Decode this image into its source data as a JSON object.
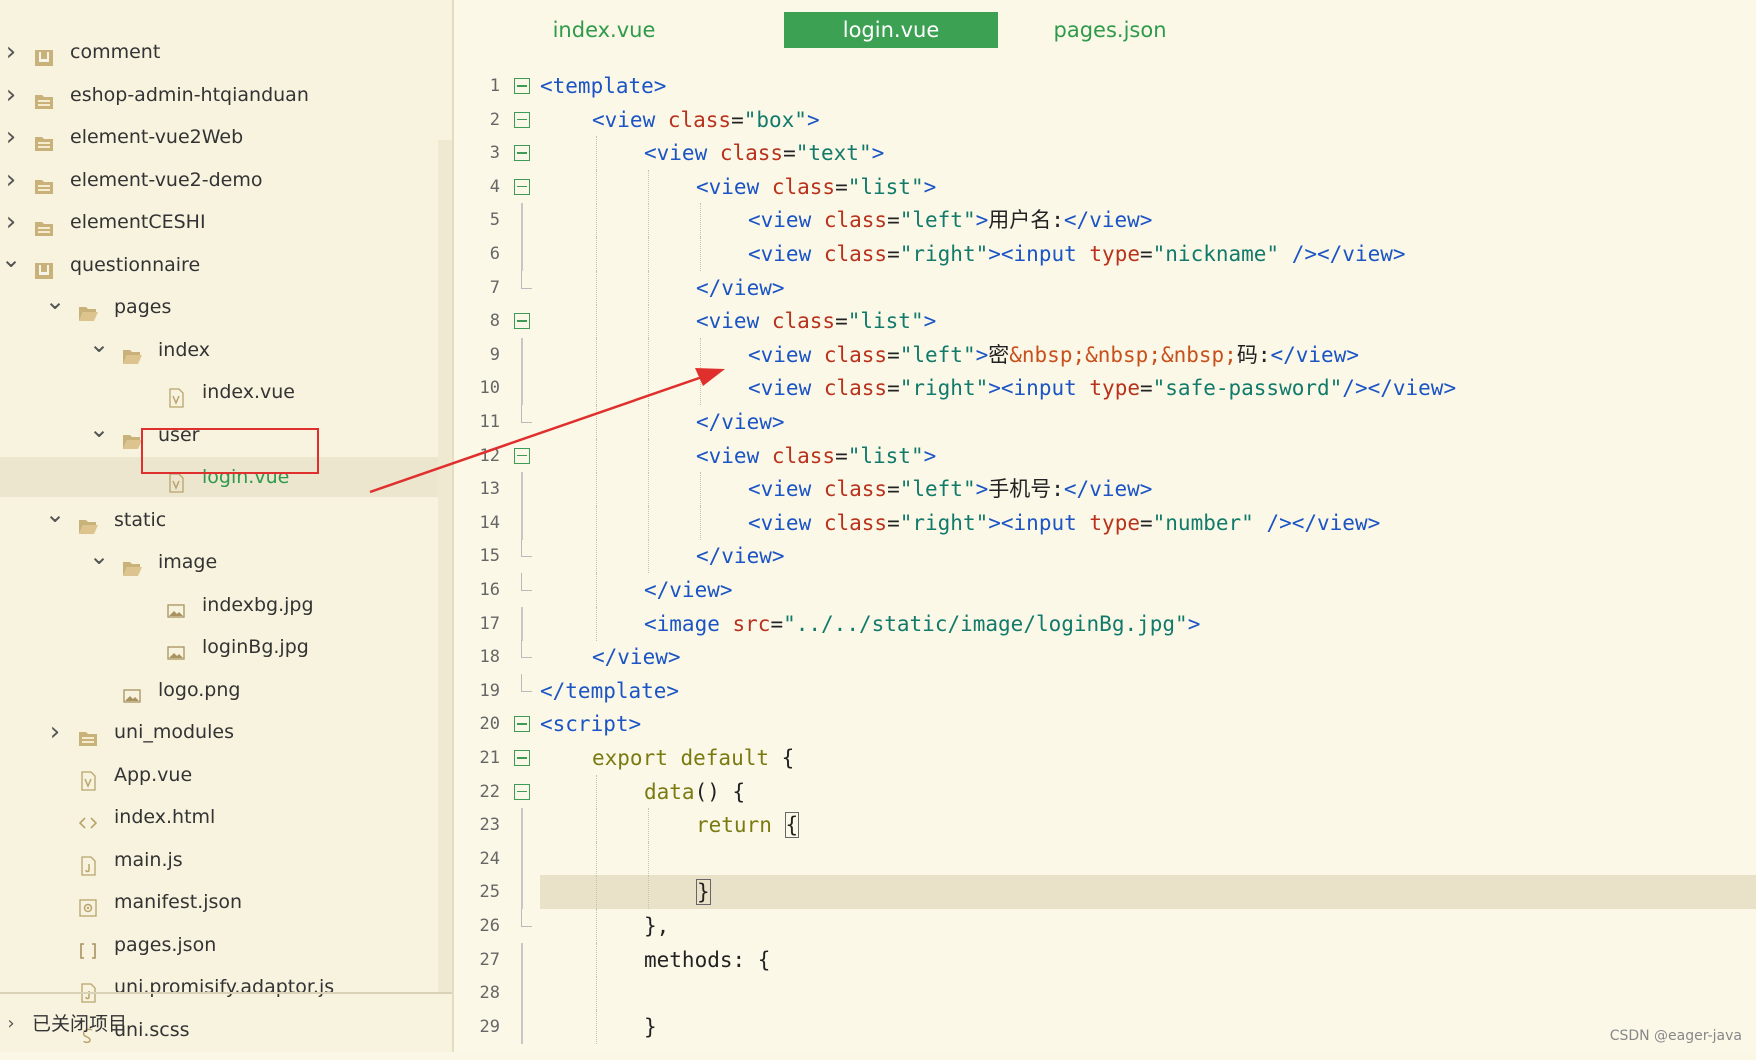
{
  "tabs": [
    {
      "label": "index.vue",
      "active": false
    },
    {
      "label": "login.vue",
      "active": true
    },
    {
      "label": "pages.json",
      "active": false
    }
  ],
  "tree": [
    {
      "label": "comment",
      "depth": 0,
      "expand": "collapsed",
      "icon": "project-icon"
    },
    {
      "label": "eshop-admin-htqianduan",
      "depth": 0,
      "expand": "collapsed",
      "icon": "folder-icon"
    },
    {
      "label": "element-vue2Web",
      "depth": 0,
      "expand": "collapsed",
      "icon": "folder-icon"
    },
    {
      "label": "element-vue2-demo",
      "depth": 0,
      "expand": "collapsed",
      "icon": "folder-icon"
    },
    {
      "label": "elementCESHI",
      "depth": 0,
      "expand": "collapsed",
      "icon": "folder-icon"
    },
    {
      "label": "questionnaire",
      "depth": 0,
      "expand": "expanded",
      "icon": "project-icon"
    },
    {
      "label": "pages",
      "depth": 1,
      "expand": "expanded",
      "icon": "open-folder-icon"
    },
    {
      "label": "index",
      "depth": 2,
      "expand": "expanded",
      "icon": "open-folder-icon"
    },
    {
      "label": "index.vue",
      "depth": 3,
      "expand": "none",
      "icon": "vue-file-icon"
    },
    {
      "label": "user",
      "depth": 2,
      "expand": "expanded",
      "icon": "open-folder-icon"
    },
    {
      "label": "login.vue",
      "depth": 3,
      "expand": "none",
      "icon": "vue-file-icon",
      "selected": true
    },
    {
      "label": "static",
      "depth": 1,
      "expand": "expanded",
      "icon": "open-folder-icon"
    },
    {
      "label": "image",
      "depth": 2,
      "expand": "expanded",
      "icon": "open-folder-icon"
    },
    {
      "label": "indexbg.jpg",
      "depth": 3,
      "expand": "none",
      "icon": "image-file-icon"
    },
    {
      "label": "loginBg.jpg",
      "depth": 3,
      "expand": "none",
      "icon": "image-file-icon"
    },
    {
      "label": "logo.png",
      "depth": 2,
      "expand": "none",
      "icon": "image-file-icon"
    },
    {
      "label": "uni_modules",
      "depth": 1,
      "expand": "collapsed",
      "icon": "folder-icon"
    },
    {
      "label": "App.vue",
      "depth": 1,
      "expand": "none",
      "icon": "vue-file-icon"
    },
    {
      "label": "index.html",
      "depth": 1,
      "expand": "none",
      "icon": "html-file-icon"
    },
    {
      "label": "main.js",
      "depth": 1,
      "expand": "none",
      "icon": "js-file-icon"
    },
    {
      "label": "manifest.json",
      "depth": 1,
      "expand": "none",
      "icon": "manifest-file-icon"
    },
    {
      "label": "pages.json",
      "depth": 1,
      "expand": "none",
      "icon": "json-file-icon"
    },
    {
      "label": "uni.promisify.adaptor.js",
      "depth": 1,
      "expand": "none",
      "icon": "js-file-icon"
    },
    {
      "label": "uni.scss",
      "depth": 1,
      "expand": "none",
      "icon": "scss-file-icon"
    }
  ],
  "closed_projects": "已关闭项目",
  "code_lines": [
    {
      "n": "1",
      "marker": "fold",
      "indent": 0,
      "tokens": [
        [
          "t",
          "<template>"
        ]
      ]
    },
    {
      "n": "2",
      "marker": "fold",
      "indent": 1,
      "tokens": [
        [
          "t",
          "<view "
        ],
        [
          "a",
          "class"
        ],
        [
          "x",
          "="
        ],
        [
          "s",
          "\"box\""
        ],
        [
          "t",
          ">"
        ]
      ]
    },
    {
      "n": "3",
      "marker": "fold",
      "indent": 2,
      "tokens": [
        [
          "t",
          "<view "
        ],
        [
          "a",
          "class"
        ],
        [
          "x",
          "="
        ],
        [
          "s",
          "\"text\""
        ],
        [
          "t",
          ">"
        ]
      ]
    },
    {
      "n": "4",
      "marker": "fold",
      "indent": 3,
      "tokens": [
        [
          "t",
          "<view "
        ],
        [
          "a",
          "class"
        ],
        [
          "x",
          "="
        ],
        [
          "s",
          "\"list\""
        ],
        [
          "t",
          ">"
        ]
      ]
    },
    {
      "n": "5",
      "marker": "bar",
      "indent": 4,
      "tokens": [
        [
          "t",
          "<view "
        ],
        [
          "a",
          "class"
        ],
        [
          "x",
          "="
        ],
        [
          "s",
          "\"left\""
        ],
        [
          "t",
          ">"
        ],
        [
          "x",
          "用户名:"
        ],
        [
          "t",
          "</view>"
        ]
      ]
    },
    {
      "n": "6",
      "marker": "bar",
      "indent": 4,
      "tokens": [
        [
          "t",
          "<view "
        ],
        [
          "a",
          "class"
        ],
        [
          "x",
          "="
        ],
        [
          "s",
          "\"right\""
        ],
        [
          "t",
          "><input "
        ],
        [
          "a",
          "type"
        ],
        [
          "x",
          "="
        ],
        [
          "s",
          "\"nickname\""
        ],
        [
          "x",
          " "
        ],
        [
          "t",
          "/></view>"
        ]
      ]
    },
    {
      "n": "7",
      "marker": "end",
      "indent": 3,
      "tokens": [
        [
          "t",
          "</view>"
        ]
      ]
    },
    {
      "n": "8",
      "marker": "fold",
      "indent": 3,
      "tokens": [
        [
          "t",
          "<view "
        ],
        [
          "a",
          "class"
        ],
        [
          "x",
          "="
        ],
        [
          "s",
          "\"list\""
        ],
        [
          "t",
          ">"
        ]
      ]
    },
    {
      "n": "9",
      "marker": "bar",
      "indent": 4,
      "tokens": [
        [
          "t",
          "<view "
        ],
        [
          "a",
          "class"
        ],
        [
          "x",
          "="
        ],
        [
          "s",
          "\"left\""
        ],
        [
          "t",
          ">"
        ],
        [
          "x",
          "密"
        ],
        [
          "e",
          "&nbsp;&nbsp;&nbsp;"
        ],
        [
          "x",
          "码:"
        ],
        [
          "t",
          "</view>"
        ]
      ]
    },
    {
      "n": "10",
      "marker": "bar",
      "indent": 4,
      "tokens": [
        [
          "t",
          "<view "
        ],
        [
          "a",
          "class"
        ],
        [
          "x",
          "="
        ],
        [
          "s",
          "\"right\""
        ],
        [
          "t",
          "><input "
        ],
        [
          "a",
          "type"
        ],
        [
          "x",
          "="
        ],
        [
          "s",
          "\"safe-password\""
        ],
        [
          "t",
          "/></view>"
        ]
      ]
    },
    {
      "n": "11",
      "marker": "end",
      "indent": 3,
      "tokens": [
        [
          "t",
          "</view>"
        ]
      ]
    },
    {
      "n": "12",
      "marker": "fold",
      "indent": 3,
      "tokens": [
        [
          "t",
          "<view "
        ],
        [
          "a",
          "class"
        ],
        [
          "x",
          "="
        ],
        [
          "s",
          "\"list\""
        ],
        [
          "t",
          ">"
        ]
      ]
    },
    {
      "n": "13",
      "marker": "bar",
      "indent": 4,
      "tokens": [
        [
          "t",
          "<view "
        ],
        [
          "a",
          "class"
        ],
        [
          "x",
          "="
        ],
        [
          "s",
          "\"left\""
        ],
        [
          "t",
          ">"
        ],
        [
          "x",
          "手机号:"
        ],
        [
          "t",
          "</view>"
        ]
      ]
    },
    {
      "n": "14",
      "marker": "bar",
      "indent": 4,
      "tokens": [
        [
          "t",
          "<view "
        ],
        [
          "a",
          "class"
        ],
        [
          "x",
          "="
        ],
        [
          "s",
          "\"right\""
        ],
        [
          "t",
          "><input "
        ],
        [
          "a",
          "type"
        ],
        [
          "x",
          "="
        ],
        [
          "s",
          "\"number\""
        ],
        [
          "x",
          " "
        ],
        [
          "t",
          "/></view>"
        ]
      ]
    },
    {
      "n": "15",
      "marker": "end",
      "indent": 3,
      "tokens": [
        [
          "t",
          "</view>"
        ]
      ]
    },
    {
      "n": "16",
      "marker": "end",
      "indent": 2,
      "tokens": [
        [
          "t",
          "</view>"
        ]
      ]
    },
    {
      "n": "17",
      "marker": "bar",
      "indent": 2,
      "tokens": [
        [
          "t",
          "<image "
        ],
        [
          "a",
          "src"
        ],
        [
          "x",
          "="
        ],
        [
          "s",
          "\"../../static/image/loginBg.jpg\""
        ],
        [
          "t",
          ">"
        ]
      ]
    },
    {
      "n": "18",
      "marker": "end",
      "indent": 1,
      "tokens": [
        [
          "t",
          "</view>"
        ]
      ]
    },
    {
      "n": "19",
      "marker": "end",
      "indent": 0,
      "tokens": [
        [
          "t",
          "</template>"
        ]
      ]
    },
    {
      "n": "20",
      "marker": "fold",
      "indent": 0,
      "tokens": [
        [
          "t",
          "<script>"
        ]
      ]
    },
    {
      "n": "21",
      "marker": "fold",
      "indent": 1,
      "tokens": [
        [
          "k",
          "export default"
        ],
        [
          "x",
          " {"
        ]
      ]
    },
    {
      "n": "22",
      "marker": "fold",
      "indent": 2,
      "tokens": [
        [
          "f",
          "data"
        ],
        [
          "x",
          "() {"
        ]
      ]
    },
    {
      "n": "23",
      "marker": "bar",
      "indent": 3,
      "tokens": [
        [
          "k",
          "return"
        ],
        [
          "x",
          " "
        ],
        [
          "c",
          "{"
        ]
      ]
    },
    {
      "n": "24",
      "marker": "bar",
      "indent": 3,
      "tokens": []
    },
    {
      "n": "25",
      "marker": "bar",
      "indent": 3,
      "tokens": [
        [
          "c",
          "}"
        ]
      ],
      "current": true
    },
    {
      "n": "26",
      "marker": "end",
      "indent": 2,
      "tokens": [
        [
          "x",
          "},"
        ]
      ]
    },
    {
      "n": "27",
      "marker": "bar",
      "indent": 2,
      "tokens": [
        [
          "x",
          "methods: {"
        ]
      ]
    },
    {
      "n": "28",
      "marker": "bar",
      "indent": 2,
      "tokens": []
    },
    {
      "n": "29",
      "marker": "bar",
      "indent": 2,
      "tokens": [
        [
          "x",
          "}"
        ]
      ]
    }
  ],
  "annotation_color": "#e0302e",
  "watermark": "CSDN @eager-java"
}
